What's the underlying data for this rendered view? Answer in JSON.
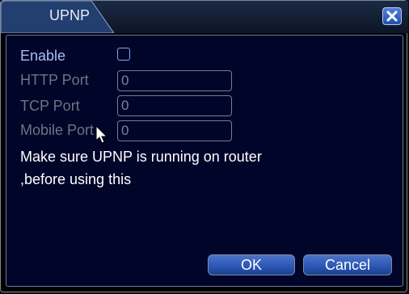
{
  "window": {
    "title": "UPNP"
  },
  "form": {
    "enable_label": "Enable",
    "enable_checked": false,
    "http_label": "HTTP Port",
    "http_value": "0",
    "tcp_label": "TCP Port",
    "tcp_value": "0",
    "mobile_label": "Mobile Port",
    "mobile_value": "0"
  },
  "note": {
    "line1": "Make sure UPNP is running on router",
    "line2": ",before using this"
  },
  "buttons": {
    "ok": "OK",
    "cancel": "Cancel"
  },
  "icons": {
    "close": "close-icon",
    "cursor": "mouse-pointer-icon"
  },
  "colors": {
    "accent": "#2a55b3",
    "panel": "#01052a"
  }
}
